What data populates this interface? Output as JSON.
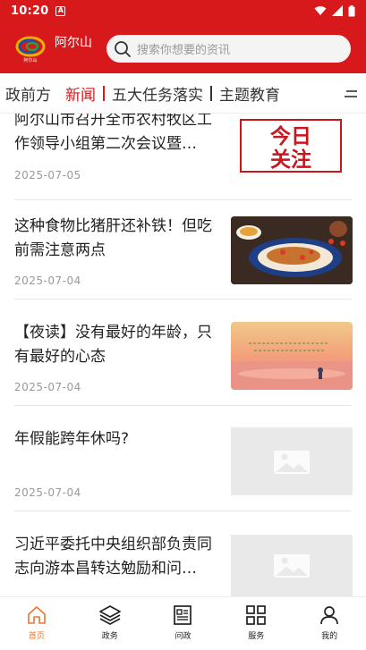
{
  "status_bar": {
    "time": "10:20",
    "notification_glyph": "A"
  },
  "header": {
    "logo_caption": "阿尔山",
    "city_name": "阿尔山",
    "search_placeholder": "搜索你想要的资讯"
  },
  "tabs": [
    {
      "label": "政前方",
      "active": false
    },
    {
      "label": "新闻",
      "active": true
    },
    {
      "label": "五大任务落实",
      "active": false
    },
    {
      "label": "主题教育",
      "active": false
    }
  ],
  "news": [
    {
      "title": "阿尔山市召开全市农村牧区工作领导小组第二次会议暨…",
      "date": "2025-07-05",
      "thumb": "jinri-guanzhu",
      "thumb_text": [
        "今日",
        "关注"
      ]
    },
    {
      "title": "这种食物比猪肝还补铁！但吃前需注意两点",
      "date": "2025-07-04",
      "thumb": "food-photo"
    },
    {
      "title": "【夜读】没有最好的年龄，只有最好的心态",
      "date": "2025-07-04",
      "thumb": "sunset-photo"
    },
    {
      "title": "年假能跨年休吗?",
      "date": "2025-07-04",
      "thumb": "placeholder"
    },
    {
      "title": "习近平委托中央组织部负责同志向游本昌转达勉励和问…",
      "date": "",
      "thumb": "placeholder"
    }
  ],
  "bottom_nav": [
    {
      "label": "首页",
      "icon": "home-icon",
      "active": true
    },
    {
      "label": "政务",
      "icon": "layers-icon",
      "active": false
    },
    {
      "label": "问政",
      "icon": "newspaper-icon",
      "active": false
    },
    {
      "label": "服务",
      "icon": "grid-icon",
      "active": false
    },
    {
      "label": "我的",
      "icon": "user-icon",
      "active": false
    }
  ],
  "colors": {
    "brand_red": "#d7191c",
    "active_nav": "#e8772e"
  }
}
